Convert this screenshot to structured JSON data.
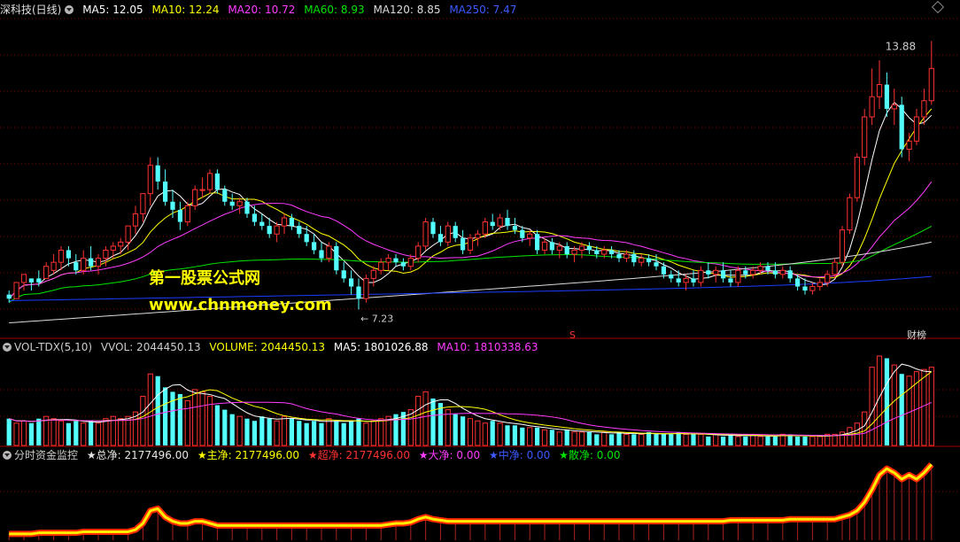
{
  "main_header": {
    "title": "深科技(日线)",
    "ma5": "MA5: 12.05",
    "ma10": "MA10: 12.24",
    "ma20": "MA20: 10.72",
    "ma60": "MA60: 8.93",
    "ma120": "MA120: 8.85",
    "ma250": "MA250: 7.47"
  },
  "vol_header": {
    "title": "VOL-TDX(5,10)",
    "vvol": "VVOL: 2044450.13",
    "volume": "VOLUME: 2044450.13",
    "ma5": "MA5: 1801026.88",
    "ma10": "MA10: 1810338.63"
  },
  "fund_header": {
    "title": "分时资金监控",
    "total": "★总净: 2177496.00",
    "main": "★主净: 2177496.00",
    "super": "★超净: 2177496.00",
    "large": "★大净: 0.00",
    "medium": "★中净: 0.00",
    "retail": "★散净: 0.00"
  },
  "annotations": {
    "high": "13.88",
    "low": "← 7.23",
    "marker_s": "S",
    "marker_fin": "财榜"
  },
  "watermark": {
    "line1": "第一股票公式网",
    "line2": "www.chnmoney.com"
  },
  "colors": {
    "up": "#ff3232",
    "down": "#54ffff",
    "ma5": "#ffffff",
    "ma10": "#ffff00",
    "ma20": "#ff3cff",
    "ma60": "#00e600",
    "ma120": "#dcdcdc",
    "ma250": "#1e3cff",
    "grid": "#8b0000"
  },
  "chart_data": {
    "type": "candlestick",
    "price_axis": [
      7.0,
      14.5
    ],
    "candles": [
      [
        7.6,
        7.7,
        7.4,
        7.5
      ],
      [
        7.5,
        7.9,
        7.5,
        7.9
      ],
      [
        7.9,
        8.1,
        7.7,
        8.1
      ],
      [
        8.0,
        8.0,
        7.7,
        7.9
      ],
      [
        8.0,
        8.2,
        7.8,
        7.9
      ],
      [
        8.0,
        8.4,
        8.0,
        8.3
      ],
      [
        8.2,
        8.6,
        8.1,
        8.4
      ],
      [
        8.4,
        8.8,
        8.2,
        8.7
      ],
      [
        8.7,
        8.8,
        8.3,
        8.5
      ],
      [
        8.4,
        8.6,
        8.1,
        8.2
      ],
      [
        8.2,
        8.7,
        8.1,
        8.5
      ],
      [
        8.5,
        8.8,
        8.2,
        8.3
      ],
      [
        8.3,
        8.6,
        8.1,
        8.5
      ],
      [
        8.5,
        8.8,
        8.3,
        8.7
      ],
      [
        8.7,
        8.9,
        8.5,
        8.8
      ],
      [
        8.8,
        9.0,
        8.6,
        8.9
      ],
      [
        8.9,
        9.3,
        8.7,
        9.3
      ],
      [
        9.3,
        9.8,
        9.1,
        9.6
      ],
      [
        9.6,
        10.1,
        9.4,
        10.1
      ],
      [
        10.1,
        11.0,
        9.8,
        10.8
      ],
      [
        10.8,
        11.0,
        10.2,
        10.4
      ],
      [
        10.4,
        10.7,
        9.8,
        9.9
      ],
      [
        9.9,
        10.2,
        9.5,
        9.7
      ],
      [
        9.7,
        9.9,
        9.2,
        9.4
      ],
      [
        9.4,
        9.9,
        9.3,
        9.8
      ],
      [
        9.8,
        10.3,
        9.7,
        10.2
      ],
      [
        10.2,
        10.5,
        10.0,
        10.2
      ],
      [
        10.2,
        10.7,
        10.1,
        10.6
      ],
      [
        10.6,
        10.7,
        10.1,
        10.2
      ],
      [
        10.2,
        10.3,
        9.8,
        9.9
      ],
      [
        9.9,
        10.1,
        9.7,
        9.8
      ],
      [
        9.8,
        10.0,
        9.6,
        9.9
      ],
      [
        9.9,
        10.0,
        9.5,
        9.6
      ],
      [
        9.6,
        9.8,
        9.3,
        9.4
      ],
      [
        9.4,
        9.6,
        9.2,
        9.3
      ],
      [
        9.3,
        9.5,
        9.0,
        9.1
      ],
      [
        9.1,
        9.4,
        8.9,
        9.3
      ],
      [
        9.3,
        9.6,
        9.1,
        9.5
      ],
      [
        9.5,
        9.6,
        9.2,
        9.3
      ],
      [
        9.3,
        9.4,
        9.0,
        9.1
      ],
      [
        9.1,
        9.3,
        8.8,
        8.9
      ],
      [
        8.9,
        9.1,
        8.6,
        8.7
      ],
      [
        8.7,
        8.9,
        8.4,
        8.5
      ],
      [
        8.5,
        8.9,
        8.4,
        8.8
      ],
      [
        8.8,
        8.9,
        8.1,
        8.2
      ],
      [
        8.2,
        8.4,
        7.9,
        8.0
      ],
      [
        8.0,
        8.2,
        7.6,
        7.8
      ],
      [
        7.8,
        8.0,
        7.23,
        7.5
      ],
      [
        7.5,
        8.1,
        7.4,
        8.0
      ],
      [
        8.0,
        8.3,
        7.8,
        8.2
      ],
      [
        8.2,
        8.5,
        8.1,
        8.4
      ],
      [
        8.4,
        8.6,
        8.2,
        8.5
      ],
      [
        8.5,
        8.6,
        8.3,
        8.4
      ],
      [
        8.4,
        8.5,
        8.2,
        8.3
      ],
      [
        8.3,
        8.6,
        8.2,
        8.5
      ],
      [
        8.5,
        8.9,
        8.4,
        8.8
      ],
      [
        8.8,
        9.5,
        8.7,
        9.4
      ],
      [
        9.4,
        9.5,
        9.0,
        9.1
      ],
      [
        9.1,
        9.3,
        8.8,
        8.9
      ],
      [
        8.9,
        9.4,
        8.8,
        9.3
      ],
      [
        9.3,
        9.4,
        8.9,
        9.0
      ],
      [
        9.0,
        9.2,
        8.6,
        8.7
      ],
      [
        8.7,
        9.1,
        8.6,
        9.0
      ],
      [
        9.0,
        9.2,
        8.8,
        9.1
      ],
      [
        9.1,
        9.5,
        9.0,
        9.4
      ],
      [
        9.4,
        9.6,
        9.2,
        9.3
      ],
      [
        9.3,
        9.6,
        9.2,
        9.5
      ],
      [
        9.5,
        9.7,
        9.2,
        9.3
      ],
      [
        9.3,
        9.5,
        9.1,
        9.2
      ],
      [
        9.2,
        9.3,
        8.9,
        9.0
      ],
      [
        9.0,
        9.2,
        8.8,
        9.1
      ],
      [
        9.1,
        9.2,
        8.6,
        8.7
      ],
      [
        8.7,
        9.0,
        8.6,
        8.9
      ],
      [
        8.9,
        9.0,
        8.6,
        8.7
      ],
      [
        8.7,
        8.9,
        8.5,
        8.8
      ],
      [
        8.8,
        8.9,
        8.5,
        8.6
      ],
      [
        8.6,
        8.8,
        8.4,
        8.7
      ],
      [
        8.7,
        8.9,
        8.5,
        8.8
      ],
      [
        8.8,
        8.9,
        8.6,
        8.7
      ],
      [
        8.7,
        8.8,
        8.5,
        8.6
      ],
      [
        8.6,
        8.8,
        8.5,
        8.7
      ],
      [
        8.7,
        8.8,
        8.5,
        8.6
      ],
      [
        8.6,
        8.7,
        8.4,
        8.5
      ],
      [
        8.5,
        8.7,
        8.4,
        8.6
      ],
      [
        8.6,
        8.7,
        8.3,
        8.4
      ],
      [
        8.4,
        8.6,
        8.3,
        8.5
      ],
      [
        8.5,
        8.6,
        8.3,
        8.4
      ],
      [
        8.4,
        8.6,
        8.2,
        8.3
      ],
      [
        8.3,
        8.4,
        8.0,
        8.1
      ],
      [
        8.1,
        8.2,
        7.9,
        8.0
      ],
      [
        8.0,
        8.2,
        7.8,
        7.9
      ],
      [
        7.9,
        8.1,
        7.7,
        8.0
      ],
      [
        8.0,
        8.2,
        7.8,
        7.9
      ],
      [
        7.9,
        8.3,
        7.8,
        8.2
      ],
      [
        8.2,
        8.4,
        8.0,
        8.1
      ],
      [
        8.1,
        8.3,
        7.9,
        8.2
      ],
      [
        8.2,
        8.4,
        7.9,
        8.0
      ],
      [
        8.0,
        8.2,
        7.8,
        7.9
      ],
      [
        7.9,
        8.3,
        7.8,
        8.2
      ],
      [
        8.2,
        8.3,
        8.0,
        8.1
      ],
      [
        8.1,
        8.3,
        8.0,
        8.2
      ],
      [
        8.2,
        8.4,
        8.1,
        8.3
      ],
      [
        8.3,
        8.4,
        8.1,
        8.2
      ],
      [
        8.2,
        8.4,
        8.0,
        8.1
      ],
      [
        8.1,
        8.3,
        8.0,
        8.2
      ],
      [
        8.2,
        8.3,
        7.9,
        8.0
      ],
      [
        8.0,
        8.1,
        7.7,
        7.8
      ],
      [
        7.8,
        8.0,
        7.6,
        7.7
      ],
      [
        7.7,
        7.9,
        7.6,
        7.8
      ],
      [
        7.8,
        8.0,
        7.7,
        7.9
      ],
      [
        7.9,
        8.2,
        7.8,
        8.1
      ],
      [
        8.1,
        8.5,
        8.0,
        8.4
      ],
      [
        8.4,
        9.3,
        8.3,
        9.2
      ],
      [
        9.2,
        10.1,
        9.1,
        10.0
      ],
      [
        10.0,
        11.1,
        9.9,
        11.0
      ],
      [
        11.0,
        12.2,
        10.8,
        12.0
      ],
      [
        12.0,
        13.2,
        11.8,
        12.5
      ],
      [
        12.5,
        13.4,
        12.2,
        12.8
      ],
      [
        12.8,
        13.1,
        12.0,
        12.2
      ],
      [
        12.2,
        12.7,
        11.8,
        12.3
      ],
      [
        12.3,
        12.5,
        11.0,
        11.2
      ],
      [
        11.2,
        11.6,
        10.9,
        11.4
      ],
      [
        11.4,
        12.2,
        11.3,
        12.0
      ],
      [
        12.0,
        12.7,
        11.8,
        12.4
      ],
      [
        12.4,
        13.88,
        12.3,
        13.2
      ]
    ],
    "volume": [
      1.2,
      1.0,
      1.1,
      1.0,
      1.2,
      1.3,
      1.2,
      1.1,
      1.0,
      1.1,
      1.0,
      1.1,
      1.0,
      1.2,
      1.3,
      1.2,
      1.3,
      1.5,
      2.2,
      3.2,
      3.1,
      2.6,
      2.4,
      2.3,
      2.0,
      2.5,
      2.4,
      2.2,
      1.8,
      1.6,
      1.4,
      1.3,
      1.2,
      1.1,
      1.3,
      1.2,
      1.1,
      1.3,
      1.2,
      1.1,
      1.0,
      1.1,
      1.0,
      1.2,
      1.1,
      1.0,
      1.1,
      1.2,
      1.0,
      1.1,
      1.2,
      1.3,
      1.4,
      1.5,
      1.6,
      2.2,
      2.4,
      2.1,
      1.9,
      1.6,
      1.4,
      1.3,
      1.2,
      1.1,
      1.0,
      1.1,
      1.0,
      0.9,
      0.9,
      0.8,
      0.8,
      0.8,
      0.7,
      0.7,
      0.6,
      0.7,
      0.6,
      0.6,
      0.6,
      0.5,
      0.6,
      0.5,
      0.6,
      0.5,
      0.5,
      0.5,
      0.6,
      0.5,
      0.5,
      0.5,
      0.6,
      0.5,
      0.5,
      0.5,
      0.4,
      0.5,
      0.4,
      0.5,
      0.4,
      0.4,
      0.5,
      0.4,
      0.4,
      0.4,
      0.5,
      0.5,
      0.4,
      0.4,
      0.4,
      0.4,
      0.5,
      0.5,
      0.6,
      0.8,
      1.0,
      1.5,
      3.5,
      4.0,
      3.9,
      3.6,
      3.2,
      3.1,
      3.3,
      3.4,
      3.5
    ],
    "fund_flow": [
      0.3,
      0.3,
      0.3,
      0.3,
      0.35,
      0.35,
      0.35,
      0.35,
      0.35,
      0.35,
      0.4,
      0.4,
      0.4,
      0.4,
      0.4,
      0.4,
      0.4,
      0.5,
      0.8,
      1.4,
      1.5,
      1.1,
      0.9,
      0.8,
      0.8,
      0.9,
      0.9,
      0.8,
      0.7,
      0.7,
      0.7,
      0.7,
      0.7,
      0.7,
      0.7,
      0.7,
      0.7,
      0.7,
      0.7,
      0.7,
      0.7,
      0.7,
      0.7,
      0.7,
      0.7,
      0.7,
      0.7,
      0.7,
      0.7,
      0.7,
      0.7,
      0.75,
      0.8,
      0.8,
      0.85,
      1.0,
      1.1,
      1.0,
      0.95,
      0.9,
      0.9,
      0.9,
      0.9,
      0.9,
      0.9,
      0.9,
      0.9,
      0.9,
      0.9,
      0.9,
      0.9,
      0.9,
      0.9,
      0.9,
      0.9,
      0.9,
      0.9,
      0.9,
      0.9,
      0.9,
      0.9,
      0.9,
      0.9,
      0.9,
      0.9,
      0.9,
      0.9,
      0.9,
      0.9,
      0.9,
      0.9,
      0.9,
      0.9,
      0.9,
      0.9,
      0.9,
      0.9,
      0.95,
      0.95,
      0.95,
      0.95,
      0.95,
      0.95,
      0.95,
      0.95,
      1.0,
      1.0,
      1.0,
      1.0,
      1.0,
      1.0,
      1.0,
      1.1,
      1.2,
      1.4,
      1.8,
      2.4,
      3.1,
      3.4,
      3.2,
      2.9,
      3.1,
      2.9,
      3.2,
      3.6
    ]
  }
}
